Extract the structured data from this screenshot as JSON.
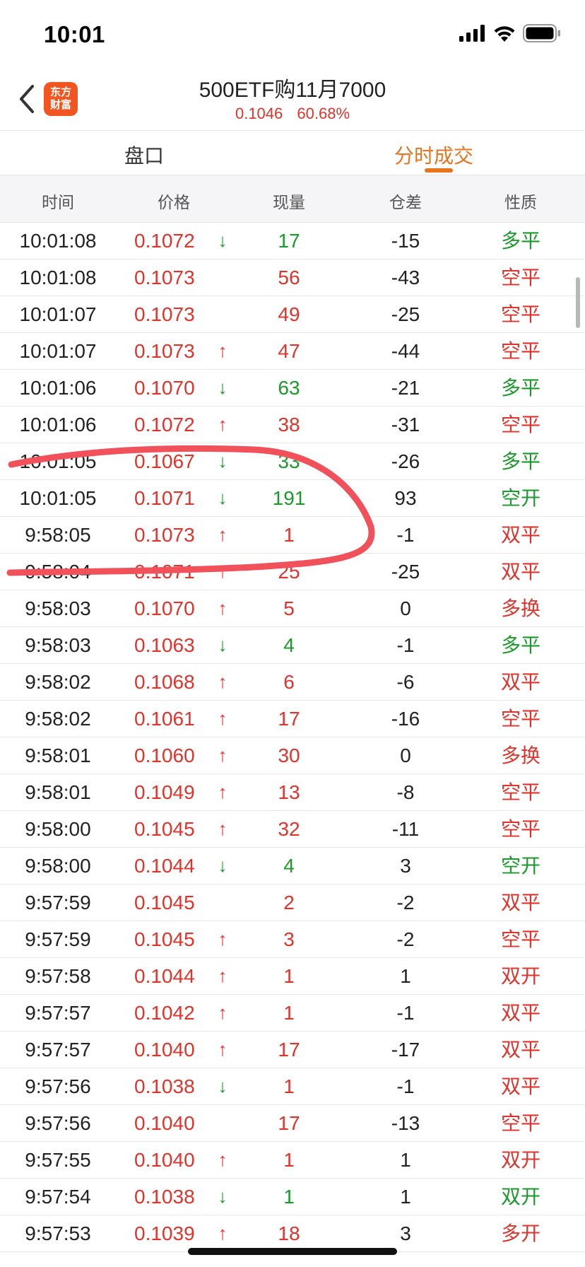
{
  "status_bar": {
    "time": "10:01"
  },
  "header": {
    "logo_text": "东方财富",
    "title": "500ETF购11月7000",
    "price": "0.1046",
    "change_pct": "60.68%"
  },
  "tabs": [
    {
      "label": "盘口",
      "active": false
    },
    {
      "label": "分时成交",
      "active": true
    }
  ],
  "table": {
    "columns": [
      "时间",
      "价格",
      "现量",
      "仓差",
      "性质"
    ],
    "rows": [
      {
        "time": "10:01:08",
        "price": "0.1072",
        "arrow": "↓",
        "volume": "17",
        "diff": "-15",
        "nature": "多平",
        "color": "green"
      },
      {
        "time": "10:01:08",
        "price": "0.1073",
        "arrow": "",
        "volume": "56",
        "diff": "-43",
        "nature": "空平",
        "color": "red"
      },
      {
        "time": "10:01:07",
        "price": "0.1073",
        "arrow": "",
        "volume": "49",
        "diff": "-25",
        "nature": "空平",
        "color": "red"
      },
      {
        "time": "10:01:07",
        "price": "0.1073",
        "arrow": "↑",
        "volume": "47",
        "diff": "-44",
        "nature": "空平",
        "color": "red"
      },
      {
        "time": "10:01:06",
        "price": "0.1070",
        "arrow": "↓",
        "volume": "63",
        "diff": "-21",
        "nature": "多平",
        "color": "green"
      },
      {
        "time": "10:01:06",
        "price": "0.1072",
        "arrow": "↑",
        "volume": "38",
        "diff": "-31",
        "nature": "空平",
        "color": "red"
      },
      {
        "time": "10:01:05",
        "price": "0.1067",
        "arrow": "↓",
        "volume": "33",
        "diff": "-26",
        "nature": "多平",
        "color": "green"
      },
      {
        "time": "10:01:05",
        "price": "0.1071",
        "arrow": "↓",
        "volume": "191",
        "diff": "93",
        "nature": "空开",
        "color": "green"
      },
      {
        "time": "9:58:05",
        "price": "0.1073",
        "arrow": "↑",
        "volume": "1",
        "diff": "-1",
        "nature": "双平",
        "color": "red"
      },
      {
        "time": "9:58:04",
        "price": "0.1071",
        "arrow": "↑",
        "volume": "25",
        "diff": "-25",
        "nature": "双平",
        "color": "red"
      },
      {
        "time": "9:58:03",
        "price": "0.1070",
        "arrow": "↑",
        "volume": "5",
        "diff": "0",
        "nature": "多换",
        "color": "red"
      },
      {
        "time": "9:58:03",
        "price": "0.1063",
        "arrow": "↓",
        "volume": "4",
        "diff": "-1",
        "nature": "多平",
        "color": "green"
      },
      {
        "time": "9:58:02",
        "price": "0.1068",
        "arrow": "↑",
        "volume": "6",
        "diff": "-6",
        "nature": "双平",
        "color": "red"
      },
      {
        "time": "9:58:02",
        "price": "0.1061",
        "arrow": "↑",
        "volume": "17",
        "diff": "-16",
        "nature": "空平",
        "color": "red"
      },
      {
        "time": "9:58:01",
        "price": "0.1060",
        "arrow": "↑",
        "volume": "30",
        "diff": "0",
        "nature": "多换",
        "color": "red"
      },
      {
        "time": "9:58:01",
        "price": "0.1049",
        "arrow": "↑",
        "volume": "13",
        "diff": "-8",
        "nature": "空平",
        "color": "red"
      },
      {
        "time": "9:58:00",
        "price": "0.1045",
        "arrow": "↑",
        "volume": "32",
        "diff": "-11",
        "nature": "空平",
        "color": "red"
      },
      {
        "time": "9:58:00",
        "price": "0.1044",
        "arrow": "↓",
        "volume": "4",
        "diff": "3",
        "nature": "空开",
        "color": "green"
      },
      {
        "time": "9:57:59",
        "price": "0.1045",
        "arrow": "",
        "volume": "2",
        "diff": "-2",
        "nature": "双平",
        "color": "red"
      },
      {
        "time": "9:57:59",
        "price": "0.1045",
        "arrow": "↑",
        "volume": "3",
        "diff": "-2",
        "nature": "空平",
        "color": "red"
      },
      {
        "time": "9:57:58",
        "price": "0.1044",
        "arrow": "↑",
        "volume": "1",
        "diff": "1",
        "nature": "双开",
        "color": "red"
      },
      {
        "time": "9:57:57",
        "price": "0.1042",
        "arrow": "↑",
        "volume": "1",
        "diff": "-1",
        "nature": "双平",
        "color": "red"
      },
      {
        "time": "9:57:57",
        "price": "0.1040",
        "arrow": "↑",
        "volume": "17",
        "diff": "-17",
        "nature": "双平",
        "color": "red"
      },
      {
        "time": "9:57:56",
        "price": "0.1038",
        "arrow": "↓",
        "volume": "1",
        "diff": "-1",
        "nature": "双平",
        "color": "red"
      },
      {
        "time": "9:57:56",
        "price": "0.1040",
        "arrow": "",
        "volume": "17",
        "diff": "-13",
        "nature": "空平",
        "color": "red"
      },
      {
        "time": "9:57:55",
        "price": "0.1040",
        "arrow": "↑",
        "volume": "1",
        "diff": "1",
        "nature": "双开",
        "color": "red"
      },
      {
        "time": "9:57:54",
        "price": "0.1038",
        "arrow": "↓",
        "volume": "1",
        "diff": "1",
        "nature": "双开",
        "color": "green"
      },
      {
        "time": "9:57:53",
        "price": "0.1039",
        "arrow": "↑",
        "volume": "18",
        "diff": "3",
        "nature": "多开",
        "color": "red"
      }
    ]
  },
  "colors": {
    "red": "#e0332c",
    "green": "#1a9a2a",
    "orange": "#e8741e",
    "annotation": "#f0515a"
  }
}
